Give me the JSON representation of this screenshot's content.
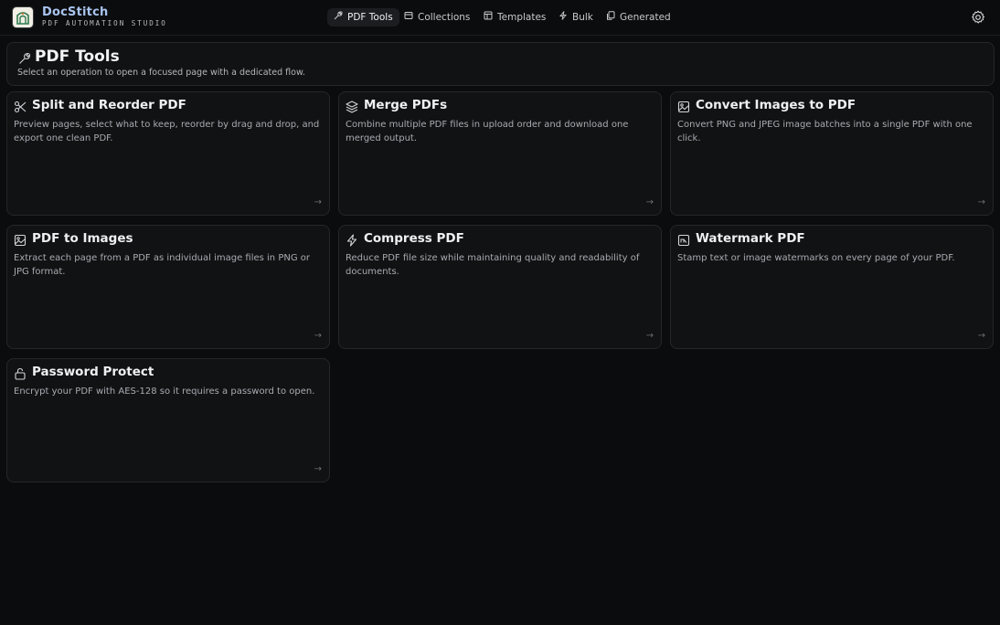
{
  "brand": {
    "name": "DocStitch",
    "subtitle": "PDF AUTOMATION STUDIO"
  },
  "nav": [
    {
      "label": "PDF Tools",
      "icon": "wrench-icon",
      "active": true
    },
    {
      "label": "Collections",
      "icon": "folder-icon",
      "active": false
    },
    {
      "label": "Templates",
      "icon": "template-icon",
      "active": false
    },
    {
      "label": "Bulk",
      "icon": "bolt-icon",
      "active": false
    },
    {
      "label": "Generated",
      "icon": "files-icon",
      "active": false
    }
  ],
  "header": {
    "title": "PDF Tools",
    "subtitle": "Select an operation to open a focused page with a dedicated flow."
  },
  "cards": [
    {
      "title": "Split and Reorder PDF",
      "description": "Preview pages, select what to keep, reorder by drag and drop, and export one clean PDF.",
      "icon": "scissors-icon",
      "arrow": "→"
    },
    {
      "title": "Merge PDFs",
      "description": "Combine multiple PDF files in upload order and download one merged output.",
      "icon": "layers-icon",
      "arrow": "→"
    },
    {
      "title": "Convert Images to PDF",
      "description": "Convert PNG and JPEG image batches into a single PDF with one click.",
      "icon": "image-icon",
      "arrow": "→"
    },
    {
      "title": "PDF to Images",
      "description": "Extract each page from a PDF as individual image files in PNG or JPG format.",
      "icon": "image-icon",
      "arrow": "→"
    },
    {
      "title": "Compress PDF",
      "description": "Reduce PDF file size while maintaining quality and readability of documents.",
      "icon": "bolt-icon",
      "arrow": "→"
    },
    {
      "title": "Watermark PDF",
      "description": "Stamp text or image watermarks on every page of your PDF.",
      "icon": "stamp-icon",
      "arrow": "→"
    },
    {
      "title": "Password Protect",
      "description": "Encrypt your PDF with AES-128 so it requires a password to open.",
      "icon": "lock-icon",
      "arrow": "→"
    }
  ],
  "colors": {
    "background": "#0b0c0d",
    "card": "#111214",
    "border": "#24272b",
    "brand_text": "#a9c4ef"
  }
}
